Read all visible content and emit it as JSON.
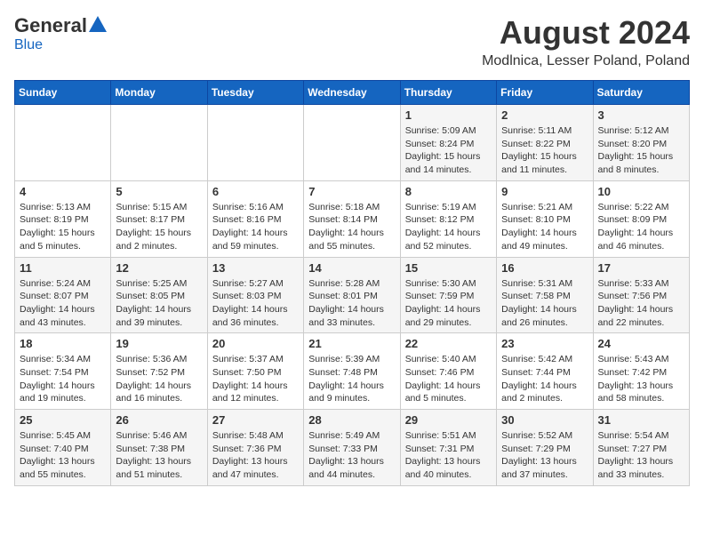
{
  "logo": {
    "general": "General",
    "blue": "Blue"
  },
  "title": "August 2024",
  "location": "Modlnica, Lesser Poland, Poland",
  "days_header": [
    "Sunday",
    "Monday",
    "Tuesday",
    "Wednesday",
    "Thursday",
    "Friday",
    "Saturday"
  ],
  "weeks": [
    [
      {
        "day": "",
        "info": ""
      },
      {
        "day": "",
        "info": ""
      },
      {
        "day": "",
        "info": ""
      },
      {
        "day": "",
        "info": ""
      },
      {
        "day": "1",
        "info": "Sunrise: 5:09 AM\nSunset: 8:24 PM\nDaylight: 15 hours\nand 14 minutes."
      },
      {
        "day": "2",
        "info": "Sunrise: 5:11 AM\nSunset: 8:22 PM\nDaylight: 15 hours\nand 11 minutes."
      },
      {
        "day": "3",
        "info": "Sunrise: 5:12 AM\nSunset: 8:20 PM\nDaylight: 15 hours\nand 8 minutes."
      }
    ],
    [
      {
        "day": "4",
        "info": "Sunrise: 5:13 AM\nSunset: 8:19 PM\nDaylight: 15 hours\nand 5 minutes."
      },
      {
        "day": "5",
        "info": "Sunrise: 5:15 AM\nSunset: 8:17 PM\nDaylight: 15 hours\nand 2 minutes."
      },
      {
        "day": "6",
        "info": "Sunrise: 5:16 AM\nSunset: 8:16 PM\nDaylight: 14 hours\nand 59 minutes."
      },
      {
        "day": "7",
        "info": "Sunrise: 5:18 AM\nSunset: 8:14 PM\nDaylight: 14 hours\nand 55 minutes."
      },
      {
        "day": "8",
        "info": "Sunrise: 5:19 AM\nSunset: 8:12 PM\nDaylight: 14 hours\nand 52 minutes."
      },
      {
        "day": "9",
        "info": "Sunrise: 5:21 AM\nSunset: 8:10 PM\nDaylight: 14 hours\nand 49 minutes."
      },
      {
        "day": "10",
        "info": "Sunrise: 5:22 AM\nSunset: 8:09 PM\nDaylight: 14 hours\nand 46 minutes."
      }
    ],
    [
      {
        "day": "11",
        "info": "Sunrise: 5:24 AM\nSunset: 8:07 PM\nDaylight: 14 hours\nand 43 minutes."
      },
      {
        "day": "12",
        "info": "Sunrise: 5:25 AM\nSunset: 8:05 PM\nDaylight: 14 hours\nand 39 minutes."
      },
      {
        "day": "13",
        "info": "Sunrise: 5:27 AM\nSunset: 8:03 PM\nDaylight: 14 hours\nand 36 minutes."
      },
      {
        "day": "14",
        "info": "Sunrise: 5:28 AM\nSunset: 8:01 PM\nDaylight: 14 hours\nand 33 minutes."
      },
      {
        "day": "15",
        "info": "Sunrise: 5:30 AM\nSunset: 7:59 PM\nDaylight: 14 hours\nand 29 minutes."
      },
      {
        "day": "16",
        "info": "Sunrise: 5:31 AM\nSunset: 7:58 PM\nDaylight: 14 hours\nand 26 minutes."
      },
      {
        "day": "17",
        "info": "Sunrise: 5:33 AM\nSunset: 7:56 PM\nDaylight: 14 hours\nand 22 minutes."
      }
    ],
    [
      {
        "day": "18",
        "info": "Sunrise: 5:34 AM\nSunset: 7:54 PM\nDaylight: 14 hours\nand 19 minutes."
      },
      {
        "day": "19",
        "info": "Sunrise: 5:36 AM\nSunset: 7:52 PM\nDaylight: 14 hours\nand 16 minutes."
      },
      {
        "day": "20",
        "info": "Sunrise: 5:37 AM\nSunset: 7:50 PM\nDaylight: 14 hours\nand 12 minutes."
      },
      {
        "day": "21",
        "info": "Sunrise: 5:39 AM\nSunset: 7:48 PM\nDaylight: 14 hours\nand 9 minutes."
      },
      {
        "day": "22",
        "info": "Sunrise: 5:40 AM\nSunset: 7:46 PM\nDaylight: 14 hours\nand 5 minutes."
      },
      {
        "day": "23",
        "info": "Sunrise: 5:42 AM\nSunset: 7:44 PM\nDaylight: 14 hours\nand 2 minutes."
      },
      {
        "day": "24",
        "info": "Sunrise: 5:43 AM\nSunset: 7:42 PM\nDaylight: 13 hours\nand 58 minutes."
      }
    ],
    [
      {
        "day": "25",
        "info": "Sunrise: 5:45 AM\nSunset: 7:40 PM\nDaylight: 13 hours\nand 55 minutes."
      },
      {
        "day": "26",
        "info": "Sunrise: 5:46 AM\nSunset: 7:38 PM\nDaylight: 13 hours\nand 51 minutes."
      },
      {
        "day": "27",
        "info": "Sunrise: 5:48 AM\nSunset: 7:36 PM\nDaylight: 13 hours\nand 47 minutes."
      },
      {
        "day": "28",
        "info": "Sunrise: 5:49 AM\nSunset: 7:33 PM\nDaylight: 13 hours\nand 44 minutes."
      },
      {
        "day": "29",
        "info": "Sunrise: 5:51 AM\nSunset: 7:31 PM\nDaylight: 13 hours\nand 40 minutes."
      },
      {
        "day": "30",
        "info": "Sunrise: 5:52 AM\nSunset: 7:29 PM\nDaylight: 13 hours\nand 37 minutes."
      },
      {
        "day": "31",
        "info": "Sunrise: 5:54 AM\nSunset: 7:27 PM\nDaylight: 13 hours\nand 33 minutes."
      }
    ]
  ]
}
